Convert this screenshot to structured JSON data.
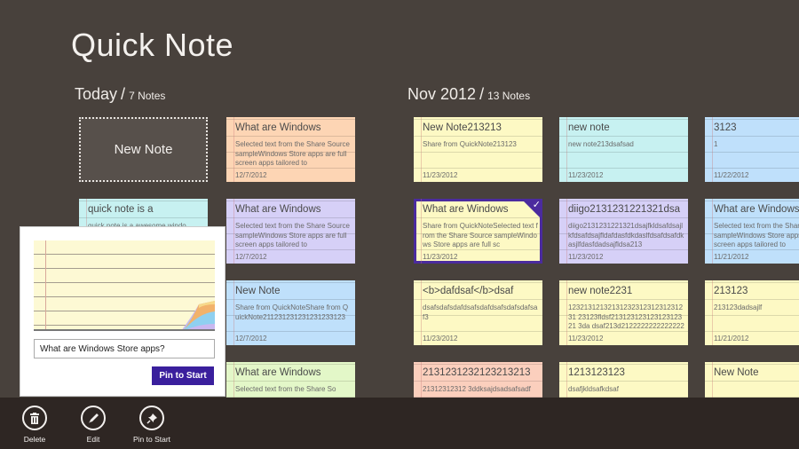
{
  "app": {
    "title": "Quick Note"
  },
  "sections": [
    {
      "label": "Today",
      "count": "7 Notes"
    },
    {
      "label": "Nov 2012",
      "count": "13 Notes"
    }
  ],
  "new_note_label": "New Note",
  "today_notes": [
    {
      "title": "What are Windows",
      "body": "Selected text from the Share Source sampleWindows Store apps are full screen apps tailored to",
      "date": "12/7/2012",
      "color": "#fdd5b4"
    },
    {
      "title": "quick note is a",
      "body": "quick note is a awesome windo",
      "date": "",
      "color": "#c7f1f1"
    },
    {
      "title": "What are Windows",
      "body": "Selected text from the Share Source sampleWindows Store apps are full screen apps tailored to",
      "date": "12/7/2012",
      "color": "#d6d0f7"
    },
    {
      "title": "New Note",
      "body": "Share from QuickNoteShare from QuickNote211231231231231233123",
      "date": "12/7/2012",
      "color": "#bfe0fb"
    },
    {
      "title": "What are Windows",
      "body": "Selected text from the Share So",
      "date": "",
      "color": "#e3f7c8"
    }
  ],
  "nov_notes": [
    {
      "title": "New Note213213",
      "body": "Share from QuickNote213123",
      "date": "11/23/2012",
      "color": "#fdf9c4"
    },
    {
      "title": "new note",
      "body": "new note213dsafsad",
      "date": "11/23/2012",
      "color": "#c7f1f1"
    },
    {
      "title": "3123",
      "body": "1",
      "date": "11/22/2012",
      "color": "#bfe0fb"
    },
    {
      "title": "What are Windows",
      "body": "Share from QuickNoteSelected text from the Share Source sampleWindows Store apps are full sc",
      "date": "11/23/2012",
      "color": "#fdf9c4",
      "selected": true
    },
    {
      "title": "diigo2131231221321dsa",
      "body": "diigo2131231221321dsajfkldsafdsajlkfdsafdsajfldafdasfdkdaslfdsafdsafdkasjlfdasfdadsajfldsa213",
      "date": "11/23/2012",
      "color": "#d6d0f7"
    },
    {
      "title": "What are Windows",
      "body": "Selected text from the Share Source sampleWindows Store apps are full screen apps tailored to",
      "date": "11/21/2012",
      "color": "#bfe0fb"
    },
    {
      "title": "<b>dafdsaf</b>dsaf",
      "body": "dsafsdafsdafdsafsdafdsafsdafsdafsaf3",
      "date": "11/23/2012",
      "color": "#fdf9c4"
    },
    {
      "title": "new note2231",
      "body": "1232131213213123231231231231231 23123fldsf21312312312312312321 3da dsaf213d2122222222222222222",
      "date": "11/23/2012",
      "color": "#fdf9c4"
    },
    {
      "title": "213123",
      "body": "213123dadsajlf",
      "date": "11/21/2012",
      "color": "#fdf9c4"
    },
    {
      "title": "2131231232123213213",
      "body": "21312312312 3ddksajdsadsafsadf",
      "date": "",
      "color": "#fbcfbd"
    },
    {
      "title": "1213123123",
      "body": "dsafjkldsafkdsaf",
      "date": "",
      "color": "#fdf9c4"
    },
    {
      "title": "New Note",
      "body": "",
      "date": "",
      "color": "#fdf9c4"
    }
  ],
  "pin_flyout": {
    "input_value": "What are Windows Store apps?",
    "button_label": "Pin to Start"
  },
  "appbar": {
    "buttons": [
      {
        "label": "Delete",
        "icon": "trash-icon"
      },
      {
        "label": "Edit",
        "icon": "pencil-icon"
      },
      {
        "label": "Pin to Start",
        "icon": "pin-icon"
      }
    ]
  },
  "colors": {
    "background": "#48413c",
    "accent": "#3a1f9d",
    "appbar": "#2e2623"
  }
}
